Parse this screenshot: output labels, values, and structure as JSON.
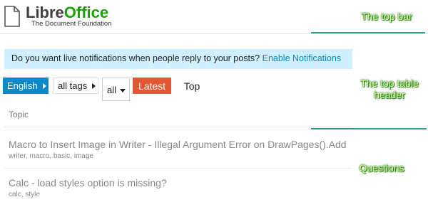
{
  "header": {
    "logo_name_dark": "Libre",
    "logo_name_green": "Office",
    "logo_subtitle": "The Document Foundation"
  },
  "annotations": {
    "top_bar": "The top bar",
    "table_header_line1": "The top table",
    "table_header_line2": "header",
    "questions": "Questions"
  },
  "banner": {
    "text": "Do you want live notifications when people reply to your posts?",
    "link": "Enable Notifications"
  },
  "filters": {
    "language": "English",
    "tags": "all tags",
    "category": "all",
    "latest": "Latest",
    "top": "Top"
  },
  "table": {
    "column_topic": "Topic",
    "rows": [
      {
        "title": "Macro to Insert Image in Writer - Illegal Argument Error on DrawPages().Add",
        "tags": [
          "writer",
          "macro",
          "basic",
          "image"
        ]
      },
      {
        "title": "Calc - load styles option is missing?",
        "tags": [
          "calc",
          "style"
        ]
      }
    ]
  },
  "colors": {
    "brand_green": "#18a303",
    "link_blue": "#0a8ac9",
    "latest_red": "#e45735",
    "banner_bg": "#d1f0ff"
  }
}
